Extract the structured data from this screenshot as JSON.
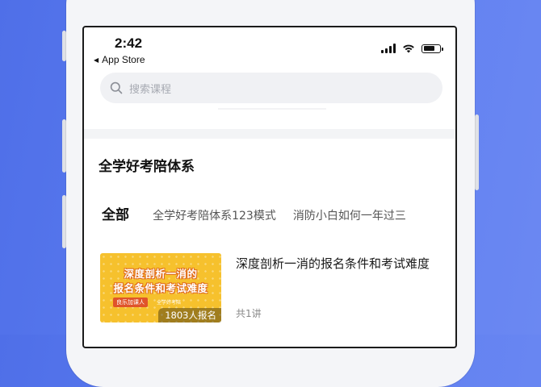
{
  "status_bar": {
    "time": "2:42",
    "back_label": "App Store",
    "back_glyph": "◀",
    "icons": [
      "cellular-signal-icon",
      "wifi-icon",
      "battery-icon"
    ]
  },
  "search": {
    "placeholder": "搜索课程",
    "icon": "search-icon"
  },
  "section": {
    "title": "全学好考陪体系"
  },
  "tabs": [
    {
      "label": "全部",
      "active": true
    },
    {
      "label": "全学好考陪体系123模式",
      "active": false
    },
    {
      "label": "消防小白如何一年过三",
      "active": false
    }
  ],
  "course": {
    "thumb_line1": "深度剖析一消的",
    "thumb_line2": "报名条件和考试难度",
    "thumb_tag": "良乐加课人",
    "thumb_sub": "全学好考陪",
    "enroll_count": "1803人报名",
    "title": "深度剖析一消的报名条件和考试难度",
    "lessons": "共1讲"
  },
  "colors": {
    "background": "#5674ec",
    "accent_yellow": "#ffd94d",
    "thumb_bg": "#f6c12d"
  }
}
